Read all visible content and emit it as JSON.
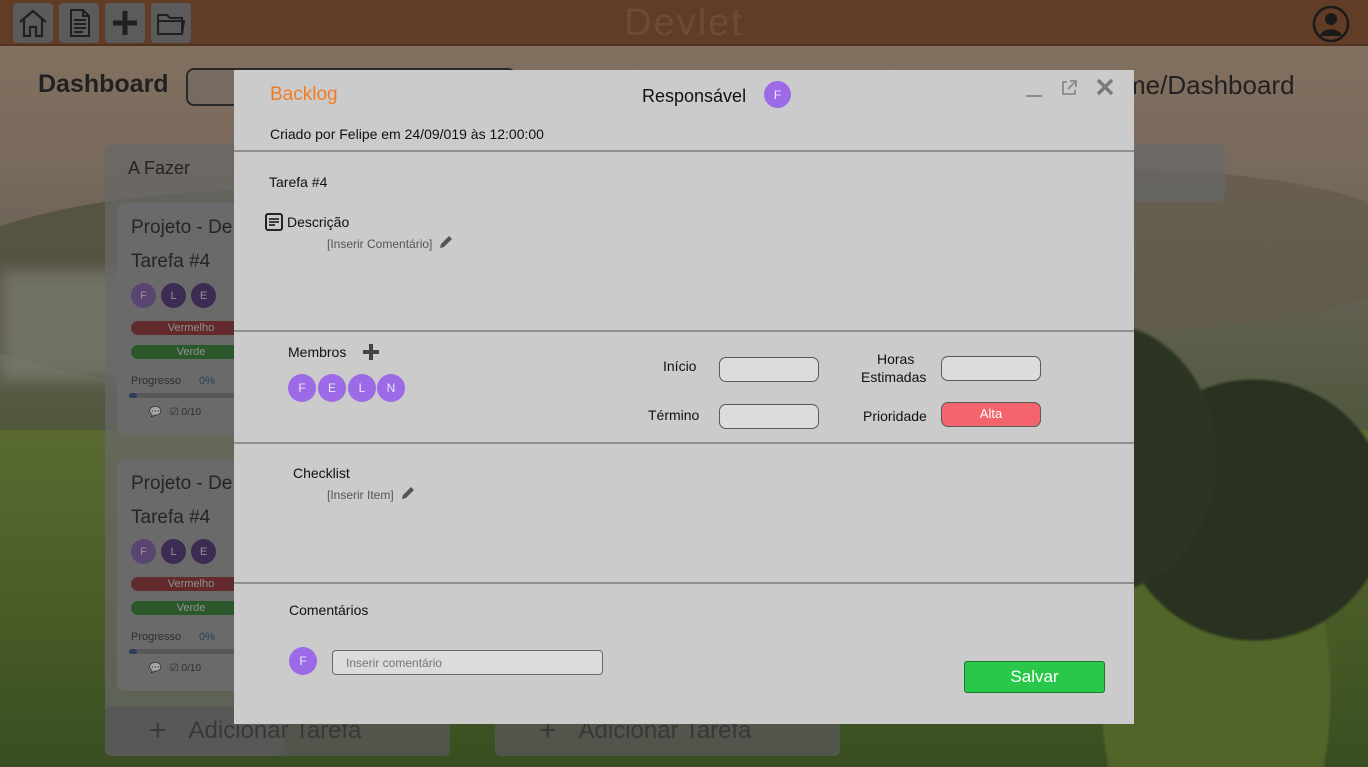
{
  "app": {
    "title": "Devlet"
  },
  "toolbar": {
    "icons": [
      "home-icon",
      "document-icon",
      "plus-icon",
      "folder-icon",
      "user-avatar-icon"
    ]
  },
  "dashboard": {
    "title": "Dashboard",
    "breadcrumb": "me/Dashboard",
    "column_title": "A Fazer",
    "add_task_label": "Adicionar Tarefa",
    "cards": [
      {
        "project": "Projeto - De",
        "task": "Tarefa #4",
        "members": [
          "F",
          "L",
          "E"
        ],
        "tag_red": "Vermelho",
        "tag_green": "Verde",
        "progress_label": "Progresso",
        "progress_value": "0%",
        "checklist": "0/10"
      },
      {
        "project": "Projeto - De",
        "task": "Tarefa #4",
        "members": [
          "F",
          "L",
          "E"
        ],
        "tag_red": "Vermelho",
        "tag_green": "Verde",
        "progress_label": "Progresso",
        "progress_value": "0%",
        "checklist": "0/10"
      }
    ]
  },
  "modal": {
    "list_name": "Backlog",
    "responsible_label": "Responsável",
    "responsible_initial": "F",
    "created_by": "Criado por Felipe em 24/09/019 às 12:00:00",
    "task_title": "Tarefa #4",
    "description_label": "Descrição",
    "description_hint": "[Inserir Comentário]",
    "members_label": "Membros",
    "members": [
      "F",
      "E",
      "L",
      "N"
    ],
    "start_label": "Início",
    "end_label": "Término",
    "hours_label_1": "Horas",
    "hours_label_2": "Estimadas",
    "priority_label": "Prioridade",
    "priority_value": "Alta",
    "checklist_label": "Checklist",
    "checklist_hint": "[Inserir Item]",
    "comments_label": "Comentários",
    "comment_avatar": "F",
    "comment_placeholder": "Inserir comentário",
    "save_label": "Salvar"
  },
  "colors": {
    "accent_orange": "#f07d26",
    "member_purple": "#9c6ae6",
    "priority_red": "#f4646c",
    "save_green": "#2ac84a",
    "appbar_brown": "#8a4d26"
  }
}
